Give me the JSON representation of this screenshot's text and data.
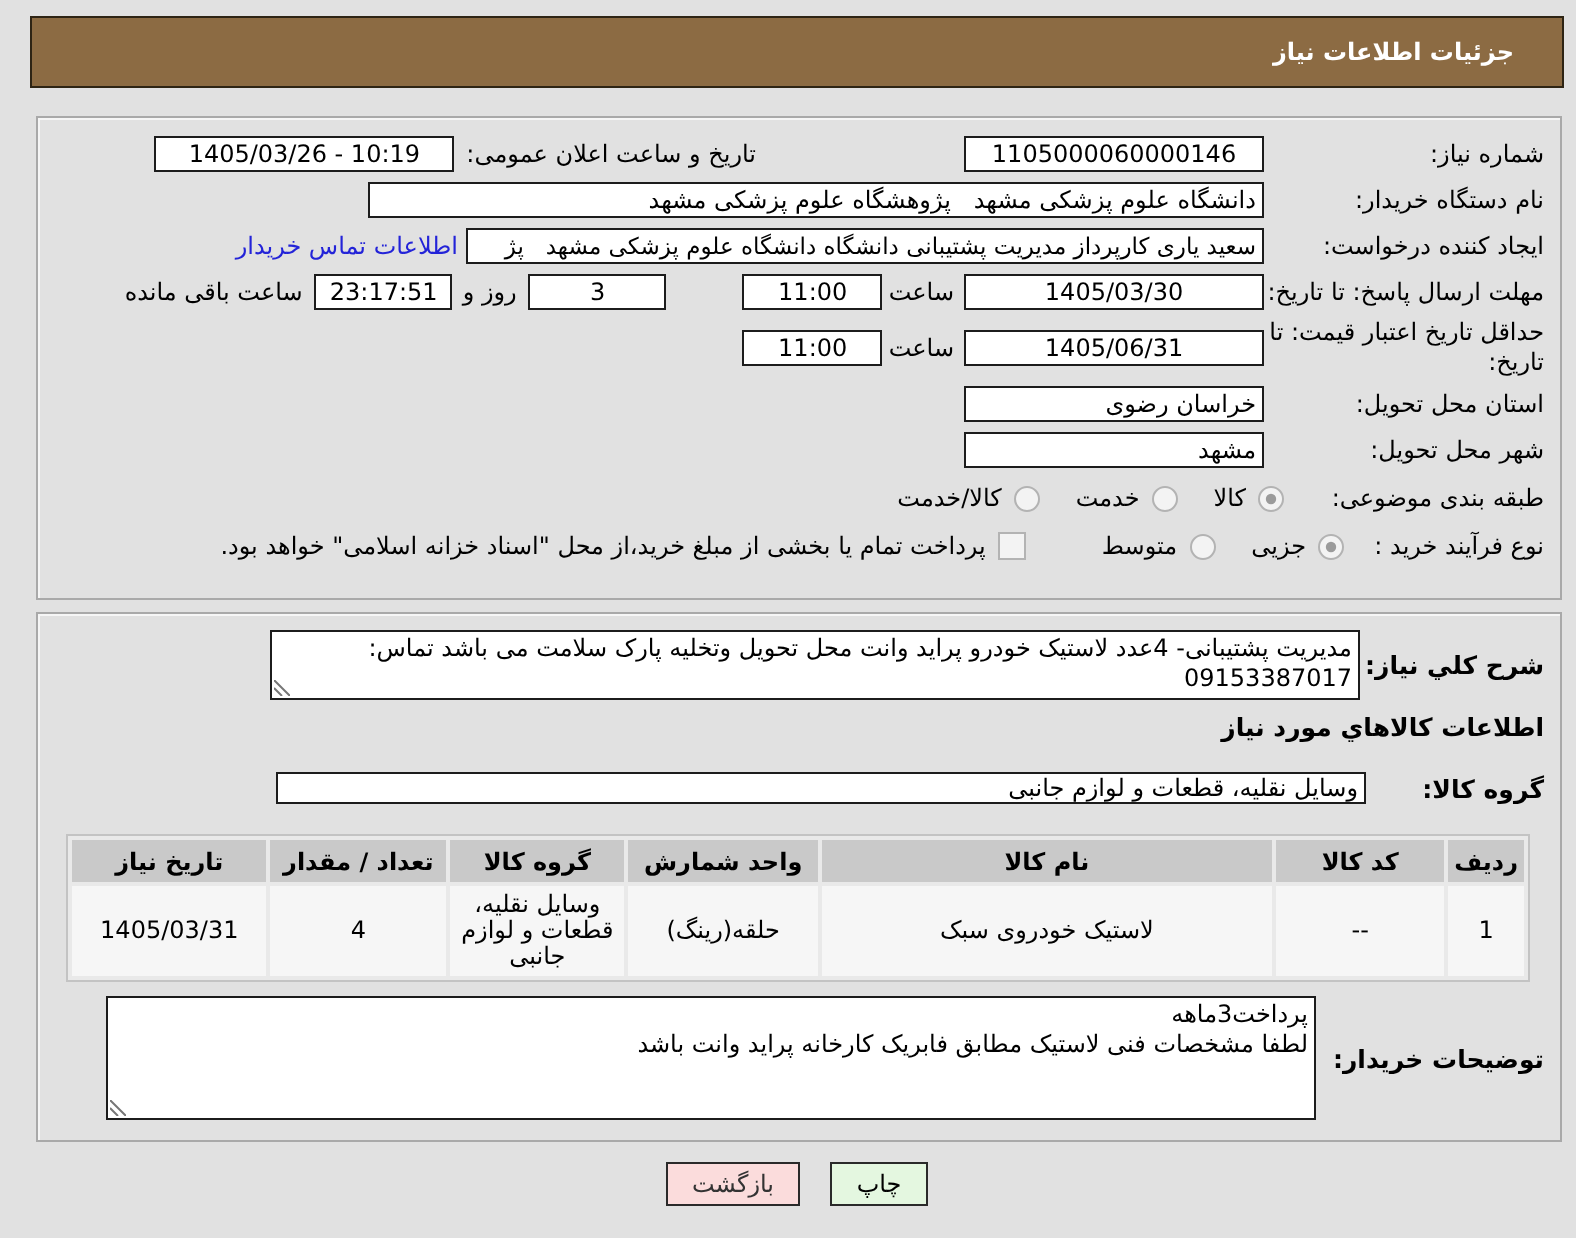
{
  "header": {
    "title": "جزئیات اطلاعات نیاز"
  },
  "need_details": {
    "need_number": {
      "label": "شماره نیاز:",
      "value": "1105000060000146"
    },
    "announcement": {
      "label": "تاریخ و ساعت اعلان عمومی:",
      "value": "1405/03/26 - 10:19"
    },
    "buyer_organization": {
      "label": "نام دستگاه خریدار:",
      "value": "دانشگاه علوم پزشکی مشهد   پژوهشگاه علوم پزشکی مشهد"
    },
    "requester": {
      "label": "ایجاد کننده درخواست:",
      "value": "سعید یاری کارپرداز مدیریت پشتیبانی دانشگاه دانشگاه علوم پزشکی مشهد   پژ",
      "contact_link": "اطلاعات تماس خریدار"
    },
    "reply_deadline": {
      "label": "مهلت ارسال پاسخ: تا تاریخ:",
      "date": "1405/03/30",
      "time_label": "ساعت",
      "time": "11:00",
      "days": "3",
      "days_label": "روز و",
      "remaining": "23:17:51",
      "remaining_label": "ساعت باقی مانده"
    },
    "price_validity": {
      "label": "حداقل تاریخ اعتبار قیمت: تا تاریخ:",
      "date": "1405/06/31",
      "time_label": "ساعت",
      "time": "11:00"
    },
    "delivery_province": {
      "label": "استان محل تحویل:",
      "value": "خراسان رضوی"
    },
    "delivery_city": {
      "label": "شهر محل تحویل:",
      "value": "مشهد"
    },
    "subject_category": {
      "label": "طبقه بندی موضوعی:",
      "options": [
        {
          "label": "کالا",
          "selected": true
        },
        {
          "label": "خدمت",
          "selected": false
        },
        {
          "label": "کالا/خدمت",
          "selected": false
        }
      ]
    },
    "purchase_type": {
      "label": "نوع فرآیند خرید :",
      "options": [
        {
          "label": "جزیی",
          "selected": true
        },
        {
          "label": "متوسط",
          "selected": false
        }
      ],
      "treasury_option": {
        "label": "پرداخت تمام یا بخشی از مبلغ خرید،از محل \"اسناد خزانه اسلامی\" خواهد بود.",
        "checked": false
      }
    }
  },
  "goods": {
    "description": {
      "label": "شرح کلي نياز:",
      "value": "مدیریت پشتیبانی- 4عدد لاستیک خودرو پراید وانت محل تحویل وتخلیه پارک سلامت  می باشد تماس: 09153387017"
    },
    "section_title": "اطلاعات کالاهاي مورد نياز",
    "goods_group": {
      "label": "گروه کالا:",
      "value": "وسایل نقلیه، قطعات و لوازم جانبی"
    },
    "table": {
      "columns": [
        "ردیف",
        "کد کالا",
        "نام کالا",
        "واحد شمارش",
        "گروه کالا",
        "تعداد / مقدار",
        "تاریخ نیاز"
      ],
      "rows": [
        [
          "1",
          "--",
          "لاستیک خودروی سبک",
          "حلقه(رینگ)",
          "وسایل نقلیه، قطعات و لوازم جانبی",
          "4",
          "1405/03/31"
        ]
      ]
    },
    "buyer_notes": {
      "label": "توضیحات خریدار:",
      "value": "پرداخت3ماهه\nلطفا مشخصات فنی لاستیک مطابق فابریک کارخانه پراید وانت باشد"
    }
  },
  "buttons": [
    {
      "label": "چاپ",
      "kind": "print"
    },
    {
      "label": "بازگشت",
      "kind": "back"
    }
  ]
}
